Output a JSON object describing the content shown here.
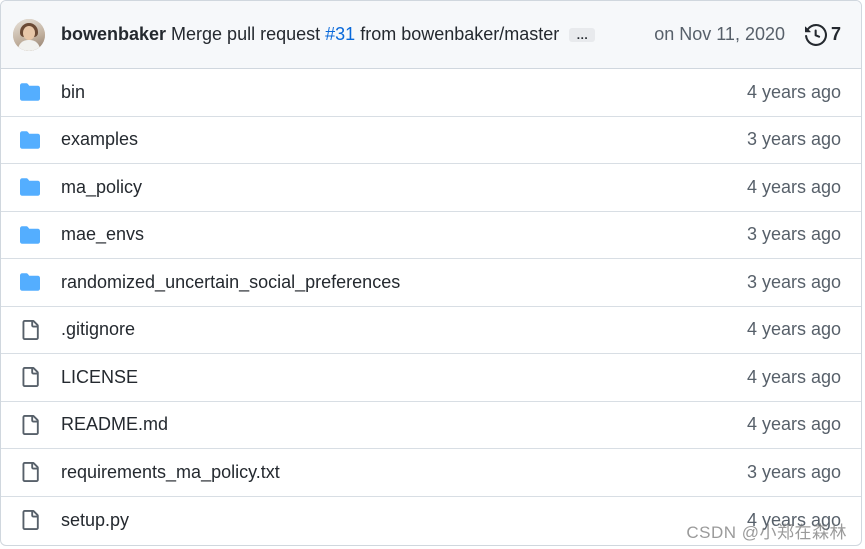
{
  "commit": {
    "author": "bowenbaker",
    "message_prefix": "Merge pull request",
    "pr_link": "#31",
    "message_suffix": "from bowenbaker/master",
    "ellipsis": "…",
    "date": "on Nov 11, 2020",
    "commit_count": "7"
  },
  "files": [
    {
      "name": "bin",
      "type": "folder",
      "age": "4 years ago"
    },
    {
      "name": "examples",
      "type": "folder",
      "age": "3 years ago"
    },
    {
      "name": "ma_policy",
      "type": "folder",
      "age": "4 years ago"
    },
    {
      "name": "mae_envs",
      "type": "folder",
      "age": "3 years ago"
    },
    {
      "name": "randomized_uncertain_social_preferences",
      "type": "folder",
      "age": "3 years ago"
    },
    {
      "name": ".gitignore",
      "type": "file",
      "age": "4 years ago"
    },
    {
      "name": "LICENSE",
      "type": "file",
      "age": "4 years ago"
    },
    {
      "name": "README.md",
      "type": "file",
      "age": "4 years ago"
    },
    {
      "name": "requirements_ma_policy.txt",
      "type": "file",
      "age": "3 years ago"
    },
    {
      "name": "setup.py",
      "type": "file",
      "age": "4 years ago"
    }
  ],
  "watermark": "CSDN @小郑在森林",
  "colors": {
    "folder": "#54aeff",
    "file": "#57606a",
    "link": "#0969da"
  }
}
